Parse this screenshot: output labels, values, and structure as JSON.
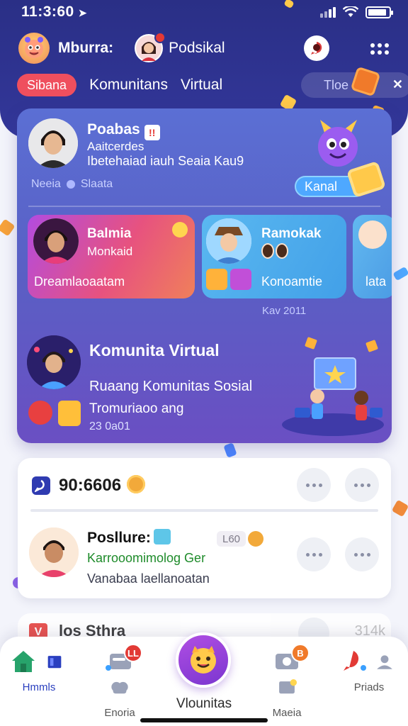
{
  "status_bar": {
    "time": "11:3:60"
  },
  "top_bar": {
    "user_name": "Mburra:",
    "contact_name": "Podsikal"
  },
  "tabs": {
    "active": "Sibana",
    "items": [
      "Komunitans",
      "Virtual"
    ],
    "search_placeholder": "Tloe"
  },
  "profile_card": {
    "name": "Poabas",
    "subtitle": "Aaitcerdes",
    "description": "Ibetehaiad iauh Seaia Kau9",
    "meta_left": "Neeia",
    "meta_right": "Slaata",
    "channel_button": "Kanal"
  },
  "sub_cards": [
    {
      "title": "Balmia",
      "subtitle": "Monkaid",
      "line": "Dreamlaoaatam"
    },
    {
      "title": "Ramokak",
      "line": "Konoamtie"
    },
    {
      "line": "lata"
    }
  ],
  "sub_cards_stamp": "Kav 2011",
  "virtual_card": {
    "title": "Komunita Virtual",
    "subtitle": "Ruaang Komunitas Sosial",
    "line": "Tromuriaoo ang",
    "date": "23 0a01"
  },
  "code_card": {
    "code": "90:6606",
    "post_title": "Posllure:",
    "post_pill": "L60",
    "post_subtitle": "Karrooomimolog Ger",
    "post_description": "Vanabaa laellanoatan"
  },
  "peek_row": {
    "icon_text": "V",
    "title": "los Sthra",
    "count": "314k"
  },
  "bottom_nav": {
    "home": "Hmmls",
    "explore": "Enoria",
    "fab": "Vlounitas",
    "media": "Maeia",
    "profile": "Priads",
    "explore_badge": "LL",
    "media_badge": "B"
  },
  "colors": {
    "header": "#2e338f",
    "active_tab": "#ef4f5e",
    "card_gradient_start": "#5b6fd4",
    "card_gradient_end": "#6a4fc3",
    "accent_blue": "#2a3fbf",
    "badge_red": "#e23a35"
  },
  "icons": {
    "mascot": "mascot-avatar-icon",
    "chat": "chat-bubble-icon",
    "more": "more-grid-icon",
    "gift": "gift-icon",
    "home": "home-icon",
    "explore": "chat-game-icon",
    "media": "media-icon",
    "profile": "person-icon"
  }
}
